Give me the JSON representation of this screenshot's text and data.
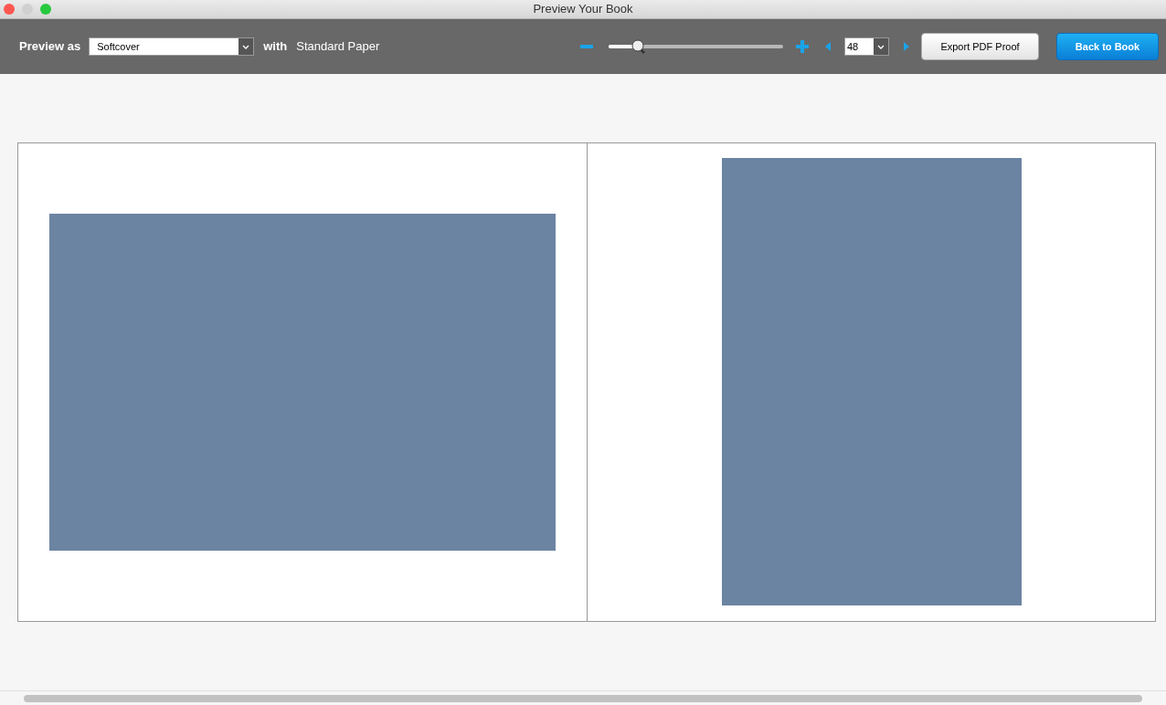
{
  "window": {
    "title": "Preview Your Book"
  },
  "toolbar": {
    "preview_label": "Preview as",
    "format": "Softcover",
    "with_label": "with",
    "paper": "Standard Paper",
    "zoom": {
      "level": 0.17
    },
    "page": "48",
    "buttons": [
      {
        "label": "Export PDF Proof",
        "kind": "secondary"
      },
      {
        "label": "Back to Book",
        "kind": "primary"
      }
    ]
  },
  "spread": {
    "pages": [
      {
        "kind": "landscape"
      },
      {
        "kind": "portrait"
      }
    ]
  }
}
